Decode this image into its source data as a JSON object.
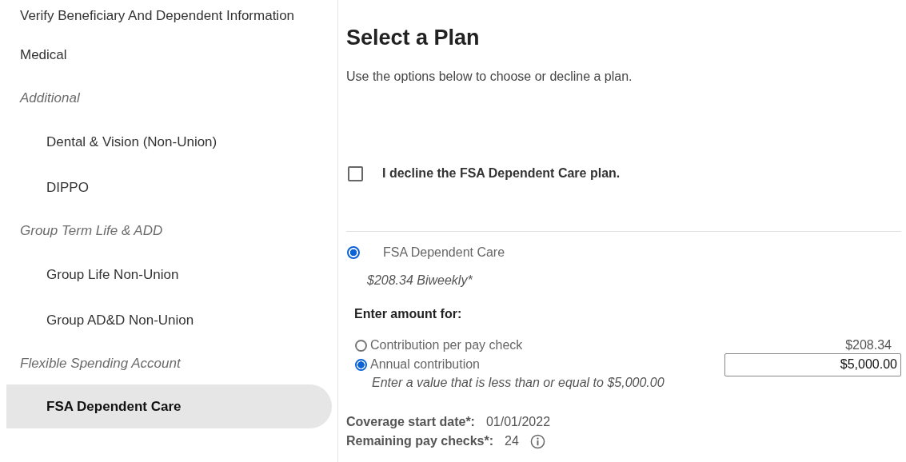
{
  "sidebar": {
    "items": [
      {
        "label": "Verify Beneficiary And Dependent Information",
        "kind": "link",
        "selected": false
      },
      {
        "label": "Medical",
        "kind": "link",
        "selected": false
      },
      {
        "label": "Additional",
        "kind": "group",
        "children": [
          {
            "label": "Dental & Vision (Non-Union)",
            "selected": false
          },
          {
            "label": "DIPPO",
            "selected": false
          }
        ]
      },
      {
        "label": "Group Term Life & ADD",
        "kind": "group",
        "children": [
          {
            "label": "Group Life Non-Union",
            "selected": false
          },
          {
            "label": "Group AD&D Non-Union",
            "selected": false
          }
        ]
      },
      {
        "label": "Flexible Spending Account",
        "kind": "group",
        "children": [
          {
            "label": "FSA Dependent Care",
            "selected": true
          }
        ]
      }
    ]
  },
  "main": {
    "title": "Select a Plan",
    "subtitle": "Use the options below to choose or decline a plan.",
    "decline": {
      "label": "I decline the FSA Dependent Care plan.",
      "checked": false
    },
    "plan": {
      "name": "FSA Dependent Care",
      "selected": true,
      "cost": "$208.34 Biweekly*"
    },
    "amount": {
      "heading": "Enter amount for:",
      "options": [
        {
          "label": "Contribution per pay check",
          "selected": false,
          "value": "$208.34"
        },
        {
          "label": "Annual contribution",
          "selected": true,
          "value": "$5,000.00"
        }
      ],
      "hint": "Enter a value that is less than or equal to $5,000.00"
    },
    "details": [
      {
        "label": "Coverage start date*:",
        "value": "01/01/2022",
        "info": false
      },
      {
        "label": "Remaining pay checks*:",
        "value": "24",
        "info": true
      }
    ]
  }
}
